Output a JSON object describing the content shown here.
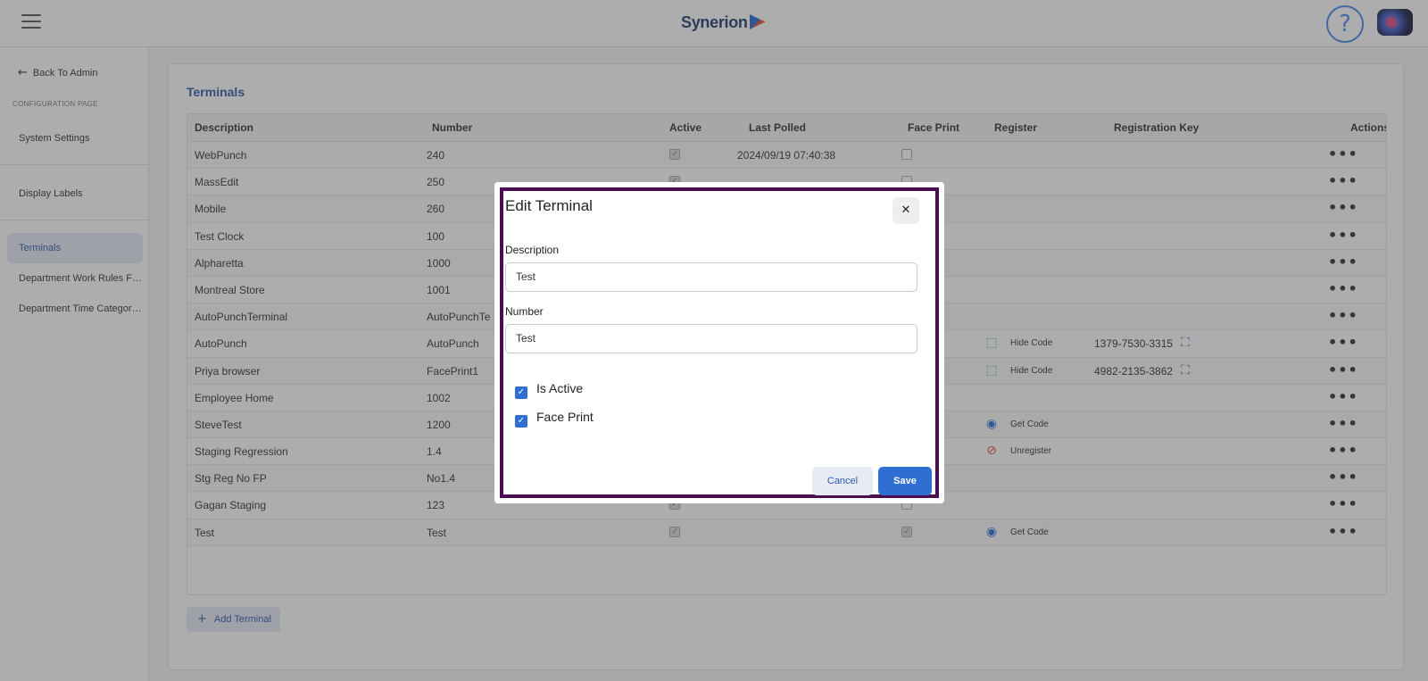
{
  "header": {
    "menu_icon": "hamburger-icon",
    "logo_text": "Synerion",
    "help_icon": "?"
  },
  "sidebar": {
    "back_label": "Back To Admin",
    "back_arrow": "←",
    "section_label": "CONFIGURATION PAGE",
    "items": [
      {
        "label": "System Settings"
      },
      {
        "label": "Display Labels"
      },
      {
        "label": "Terminals"
      },
      {
        "label": "Department Work Rules Filt..."
      },
      {
        "label": "Department Time Category ..."
      }
    ]
  },
  "main": {
    "title": "Terminals",
    "columns": [
      "Description",
      "Number",
      "Active",
      "Last Polled",
      "Face Print",
      "Register",
      "Registration Key",
      "Actions"
    ],
    "rows": [
      {
        "description": "WebPunch",
        "number": "240",
        "active": true,
        "last_polled": "2024/09/19 07:40:38",
        "face_print": false,
        "register": "",
        "key": ""
      },
      {
        "description": "MassEdit",
        "number": "250",
        "active": true,
        "last_polled": "",
        "face_print": false,
        "register": "",
        "key": ""
      },
      {
        "description": "Mobile",
        "number": "260",
        "active": true,
        "last_polled": "",
        "face_print": false,
        "register": "",
        "key": ""
      },
      {
        "description": "Test Clock",
        "number": "100",
        "active": true,
        "last_polled": "",
        "face_print": false,
        "register": "",
        "key": ""
      },
      {
        "description": "Alpharetta",
        "number": "1000",
        "active": true,
        "last_polled": "",
        "face_print": false,
        "register": "",
        "key": ""
      },
      {
        "description": "Montreal Store",
        "number": "1001",
        "active": true,
        "last_polled": "",
        "face_print": false,
        "register": "",
        "key": ""
      },
      {
        "description": "AutoPunchTerminal",
        "number": "AutoPunchTe",
        "active": true,
        "last_polled": "",
        "face_print": false,
        "register": "",
        "key": ""
      },
      {
        "description": "AutoPunch",
        "number": "AutoPunch",
        "active": true,
        "last_polled": "",
        "face_print": true,
        "register": "Hide Code",
        "key": "1379-7530-3315"
      },
      {
        "description": "Priya browser",
        "number": "FacePrint1",
        "active": true,
        "last_polled": "",
        "face_print": true,
        "register": "Hide Code",
        "key": "4982-2135-3862"
      },
      {
        "description": "Employee Home",
        "number": "1002",
        "active": true,
        "last_polled": "",
        "face_print": false,
        "register": "",
        "key": ""
      },
      {
        "description": "SteveTest",
        "number": "1200",
        "active": true,
        "last_polled": "",
        "face_print": true,
        "register": "Get Code",
        "key": ""
      },
      {
        "description": "Staging Regression",
        "number": "1.4",
        "active": true,
        "last_polled": "",
        "face_print": true,
        "register": "Unregister",
        "key": ""
      },
      {
        "description": "Stg Reg No FP",
        "number": "No1.4",
        "active": true,
        "last_polled": "",
        "face_print": false,
        "register": "",
        "key": ""
      },
      {
        "description": "Gagan Staging",
        "number": "123",
        "active": true,
        "last_polled": "",
        "face_print": false,
        "register": "",
        "key": ""
      },
      {
        "description": "Test",
        "number": "Test",
        "active": true,
        "last_polled": "",
        "face_print": true,
        "register": "Get Code",
        "key": ""
      }
    ],
    "actions_glyph": "•••",
    "add_button_label": "Add Terminal",
    "add_button_icon": "+"
  },
  "modal": {
    "title": "Edit Terminal",
    "close_glyph": "✕",
    "description_label": "Description",
    "description_value": "Test",
    "number_label": "Number",
    "number_value": "Test",
    "is_active_label": "Is Active",
    "is_active_checked": true,
    "face_print_label": "Face Print",
    "face_print_checked": true,
    "check_glyph": "✓",
    "cancel_label": "Cancel",
    "save_label": "Save"
  },
  "colors": {
    "accent": "#2f6fd1",
    "title_blue": "#2f5aa8",
    "modal_border": "#4a0f4f",
    "register_green": "#4caf50",
    "register_red": "#e04a4a"
  }
}
